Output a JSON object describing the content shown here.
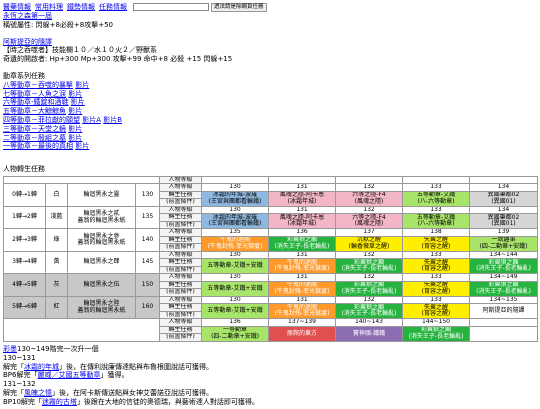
{
  "nav": {
    "links": [
      "醫藥情報",
      "常用料理",
      "鐵勢情報",
      "任務情報"
    ],
    "search_button": "透法請是除網頁任務"
  },
  "breadcrumb": "永恆之森第一屆",
  "ally_line": "稱號屬性: 閃躲+8必殺+8攻擊+50",
  "class_link": "阿斯提亞的隨譯",
  "class_desc": "【時之吞噬者】技能欄１０／水１０火２／野獸系",
  "class_stats": "奇遺的開啟者: Hp+300 Mp+300 攻擊+99 命中+8 必殺 +15 閃躲+15",
  "quest_heading": "動章系列任務",
  "quests": [
    {
      "text": "八等動章－吞噬的暴擊",
      "link": "影片"
    },
    {
      "text": "七等動章－人魚之淚",
      "link": "影片"
    },
    {
      "text": "六等動章-鐵錠和酒鞋",
      "link": "影片"
    },
    {
      "text": "五等動章－大鯨鯨魚",
      "link": "影片"
    },
    {
      "text": "四等動章－菲拉獻的願望",
      "link": "影片A",
      "link2": "影片B"
    },
    {
      "text": "三等動章－天堂之鏡",
      "link": "影片"
    },
    {
      "text": "二等動章－殷組之墓",
      "link": "影片"
    },
    {
      "text": "一等動章－最後的真相",
      "link": "影片"
    }
  ],
  "table_title": "人物轉生任務",
  "labels": {
    "level": "人物等級",
    "quest": "轉生任務",
    "prereq": "(前置條件)"
  },
  "tiers": [
    {
      "name": "0轉→1轉",
      "color": "白",
      "item": "輪迴黑永之靈",
      "lv": "130",
      "levels": [
        "130",
        "131",
        "132",
        "133",
        "134"
      ],
      "quests": [
        [
          "冰霜的年城-波羅",
          "(王宮與團都看輪鐵)"
        ],
        [
          "風魂之隱-阿卡恩",
          "(冰霜年城)"
        ],
        [
          "六等之隱-F4",
          "(風魂之隱)"
        ],
        [
          "五等動章-艾鐵",
          "(八-六等動章)"
        ],
        [
          "異國筆都02",
          "(異國01)"
        ]
      ],
      "classes": [
        "c-blue",
        "c-pink",
        "c-pink",
        "c-lime",
        "c-gray"
      ]
    },
    {
      "name": "1轉→2轉",
      "color": "淺藍",
      "item": "輪迴黑永之貳",
      "item2": "蓋翁的輪迴黑永紙",
      "lv": "135",
      "levels": [
        "130",
        "131",
        "132",
        "133",
        "134"
      ],
      "quests": [
        [
          "冰霜的年城-波羅",
          "(王宮與團都看輪鐵)"
        ],
        [
          "風魂之隱-阿卡恩",
          "(冰霜年城)"
        ],
        [
          "六等之隱-F4",
          "(風魂之隱)"
        ],
        [
          "五等動章-艾鐵",
          "(八-六等動章)"
        ],
        [
          "異國筆都02",
          "(異國01)"
        ]
      ],
      "classes": [
        "c-blue",
        "c-pink",
        "c-pink",
        "c-lime",
        "c-gray"
      ]
    },
    {
      "name": "2轉→3轉",
      "color": "綠",
      "item": "輪迴黑永之參",
      "item2": "蓋翁的輪迴黑永紙",
      "lv": "140",
      "levels": [
        "135",
        "136",
        "137",
        "138",
        "139"
      ],
      "quests": [
        [
          "牛鬼的迷關",
          "(牛鬼封残-菲光獄宴)"
        ],
        [
          "彩翼狼之願",
          "(消失王子-長老輪亂)"
        ],
        [
          "沉默之醒",
          "(輪香薇草之醒)"
        ],
        [
          "失翼之醒",
          "(育容之醒)"
        ],
        [
          "一致趣事",
          "(四-二動章+安鐵)"
        ]
      ],
      "classes": [
        "c-orange",
        "c-green",
        "c-yellow",
        "c-yellow",
        "c-lime"
      ]
    },
    {
      "name": "3轉→4轉",
      "color": "黃",
      "item": "輪迴黑永之肆",
      "lv": "145",
      "levels": [
        "130",
        "131",
        "132",
        "133",
        "134~144"
      ],
      "quests": [
        [
          "五等動章-艾鐵+安鐵"
        ],
        [
          "牛鬼的迷關",
          "(牛鬼封残-菲光獄宴)"
        ],
        [
          "彩翼狼之願",
          "(消失王子-長老輪亂)"
        ],
        [
          "失翼之醒",
          "(育容之醒)"
        ],
        [
          "彩翼狼之願",
          "(消失王子-長老輪亂)"
        ]
      ],
      "classes": [
        "c-lime",
        "c-orange",
        "c-green",
        "c-yellow",
        "c-green"
      ]
    },
    {
      "name": "4轉→5轉",
      "color": "灰",
      "item": "輪迴黑永之伍",
      "lv": "150",
      "levels": [
        "130",
        "131",
        "132",
        "133",
        "134~149"
      ],
      "quests": [
        [
          "五等動章-艾鐵+安鐵"
        ],
        [
          "牛鬼的迷關",
          "(牛鬼封残-菲光獄宴)"
        ],
        [
          "彩翼狼之願",
          "(消失王子-長老輪亂)"
        ],
        [
          "失翼之醒",
          "(育容之醒)"
        ],
        [
          "彩翼狼之願",
          "(消失王子-長老輪亂)"
        ]
      ],
      "classes": [
        "c-lime",
        "c-orange",
        "c-green",
        "c-yellow",
        "c-green"
      ]
    },
    {
      "name": "5轉→6轉",
      "color": "紅",
      "item": "輪迴黑永之陸",
      "item2": "蓋翁的輪迴黑永紙",
      "lv": "160",
      "levels": [
        "130",
        "131",
        "132",
        "133",
        "134~135"
      ],
      "quests": [
        [
          "五等動章-艾鐵+安鐵"
        ],
        [
          "牛鬼的迷關",
          "(牛鬼封残-菲光獄宴)"
        ],
        [
          "彩翼狼之願",
          "(消失王子-長老輪亂)"
        ],
        [
          "失翼之醒",
          "(育容之醒)"
        ],
        [
          "阿斯提亞的隨譯"
        ]
      ],
      "classes": [
        "c-lime",
        "c-orange",
        "c-green",
        "c-yellow",
        "c-white"
      ]
    },
    {
      "name": "",
      "color": "",
      "item": "",
      "lv": "",
      "levels": [
        "136",
        "137~139",
        "140~143",
        "144~150",
        ""
      ],
      "quests": [
        [
          "一等動章",
          "(四-二動章+安鐵)"
        ],
        [
          "原爬的東方"
        ],
        [
          "寶神頭-鐵鐵"
        ],
        [
          "彩翼狼之願",
          "(消失王子-長老輪亂)"
        ],
        [
          ""
        ]
      ],
      "classes": [
        "c-lime",
        "c-crimson",
        "c-purple",
        "c-green",
        "c-white"
      ]
    }
  ],
  "footer": {
    "l1_link": "彩墨",
    "l1_text": "130~149階完一次升一個",
    "l2": "130~131",
    "l3_pre": "解完「",
    "l3_link": "冰霜的年城",
    "l3_post": "」後，在傳利說廉傳達點與布魯根圍說話可獲得。",
    "l4_pre": "BP6解完「",
    "l4_link": "麗威／艾國五等動章",
    "l4_post": "」獲得。",
    "l5": "131~132",
    "l6_pre": "解完「",
    "l6_link": "風魄之憶",
    "l6_post": "」後，在阿卡斯傳送點與女神艾蕾諾亞說話可獲得。",
    "l7_pre": "BP10解完「",
    "l7_link": "迷霧的古塔",
    "l7_post": "」後跟在大地的信徒的奧德瑞，與藝術達人對話即可獲得。"
  }
}
